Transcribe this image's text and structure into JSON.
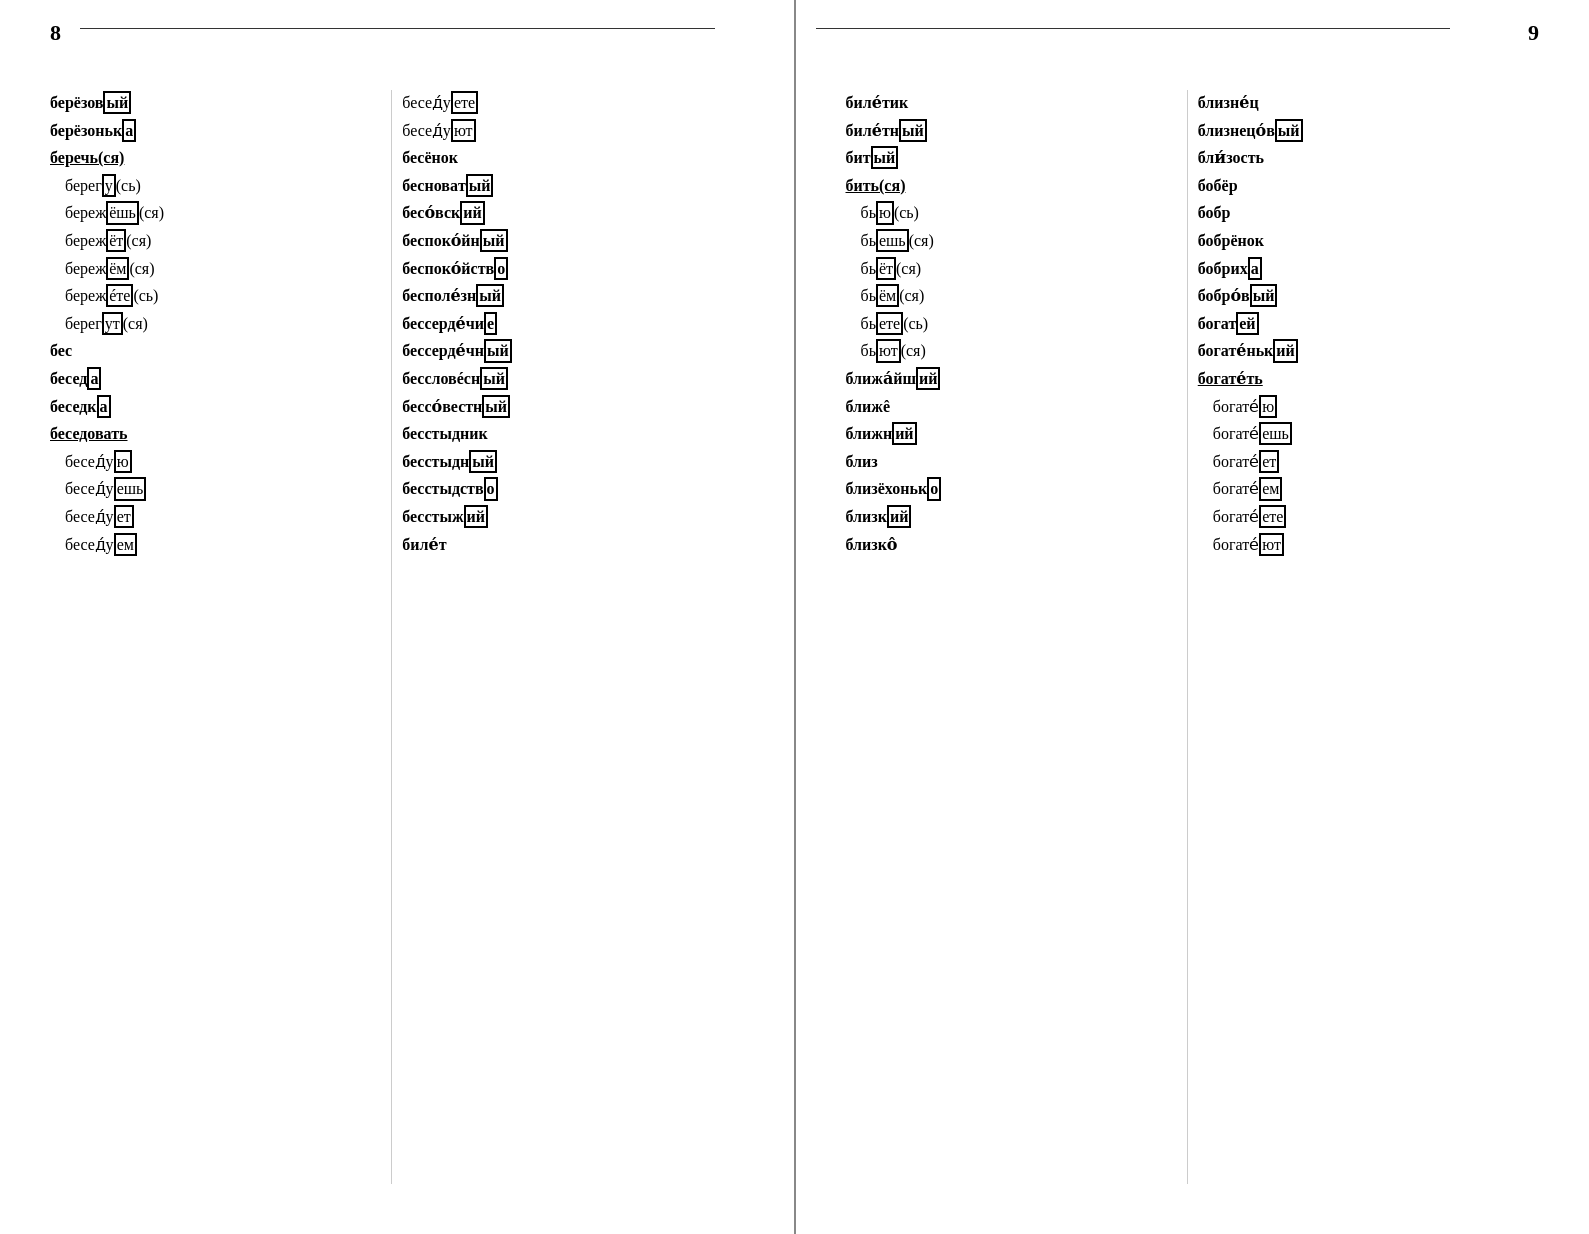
{
  "page_left": {
    "number": "8",
    "columns": [
      {
        "id": "col1",
        "entries": [
          {
            "text": "берёзов|ый",
            "bold": true
          },
          {
            "text": "берёзоньк|а",
            "bold": true
          },
          {
            "text": "беречь(ся)",
            "bold": true,
            "underline": true
          },
          {
            "text": "берег|у|(сь)",
            "bold": false,
            "indent": true
          },
          {
            "text": "береж|ёшь|(ся)",
            "bold": false,
            "indent": true
          },
          {
            "text": "береж|ёт|(ся)",
            "bold": false,
            "indent": true
          },
          {
            "text": "береж|ём|(ся)",
            "bold": false,
            "indent": true
          },
          {
            "text": "береж|éте|(сь)",
            "bold": false,
            "indent": true
          },
          {
            "text": "берег|ут|(ся)",
            "bold": false,
            "indent": true
          },
          {
            "text": "бес",
            "bold": true
          },
          {
            "text": "бесед|а",
            "bold": true
          },
          {
            "text": "беседк|а",
            "bold": true
          },
          {
            "text": "беседовать",
            "bold": true,
            "underline": true
          },
          {
            "text": "беседу|ю",
            "bold": false,
            "indent": true
          },
          {
            "text": "беседу|ешь",
            "bold": false,
            "indent": true
          },
          {
            "text": "беседу|ет",
            "bold": false,
            "indent": true
          },
          {
            "text": "беседу|ем",
            "bold": false,
            "indent": true
          }
        ]
      },
      {
        "id": "col2",
        "entries": [
          {
            "text": "беседу́|ете"
          },
          {
            "text": "беседу́|ют"
          },
          {
            "text": "бесёнок",
            "bold": true
          },
          {
            "text": "бесновáт|ый",
            "bold": true
          },
          {
            "text": "бесóвск|ий",
            "bold": true
          },
          {
            "text": "беспокóйн|ый",
            "bold": true
          },
          {
            "text": "беспокóйств|о",
            "bold": true
          },
          {
            "text": "бесполéзн|ый",
            "bold": true
          },
          {
            "text": "бессердéчи|е",
            "bold": true
          },
          {
            "text": "бессердéчн|ый",
            "bold": true
          },
          {
            "text": "бессловéсн|ый",
            "bold": true
          },
          {
            "text": "бессóвестн|ый",
            "bold": true
          },
          {
            "text": "бесстыдник",
            "bold": true
          },
          {
            "text": "бесстыдн|ый",
            "bold": true
          },
          {
            "text": "бесстыдств|о",
            "bold": true
          },
          {
            "text": "бесстыж|ий",
            "bold": true
          },
          {
            "text": "билет",
            "bold": true
          }
        ]
      }
    ]
  },
  "page_right": {
    "number": "9",
    "columns": [
      {
        "id": "col3",
        "entries": [
          {
            "text": "билетик",
            "bold": true
          },
          {
            "text": "билетн|ый",
            "bold": true
          },
          {
            "text": "бит|ый",
            "bold": true
          },
          {
            "text": "бить(ся)",
            "bold": true,
            "underline": true
          },
          {
            "text": "бь|ю|(сь)",
            "bold": false,
            "indent": true
          },
          {
            "text": "бь|ешь|(ся)",
            "bold": false,
            "indent": true
          },
          {
            "text": "бь|ёт|(ся)",
            "bold": false,
            "indent": true
          },
          {
            "text": "бь|ём|(ся)",
            "bold": false,
            "indent": true
          },
          {
            "text": "бь|ете|(сь)",
            "bold": false,
            "indent": true
          },
          {
            "text": "бь|ют|(ся)",
            "bold": false,
            "indent": true
          },
          {
            "text": "ближáйш|ий",
            "bold": true
          },
          {
            "text": "ближé",
            "bold": true
          },
          {
            "text": "ближн|ий",
            "bold": true
          },
          {
            "text": "близ",
            "bold": true
          },
          {
            "text": "близёхоньк|о",
            "bold": true
          },
          {
            "text": "близк|ий",
            "bold": true
          },
          {
            "text": "близкó",
            "bold": true
          }
        ]
      },
      {
        "id": "col4",
        "entries": [
          {
            "text": "близнéц",
            "bold": true
          },
          {
            "text": "близнецóв|ый",
            "bold": true
          },
          {
            "text": "близость",
            "bold": true
          },
          {
            "text": "бобёр",
            "bold": true
          },
          {
            "text": "бобр",
            "bold": true
          },
          {
            "text": "бобрёнок",
            "bold": true
          },
          {
            "text": "бобрих|а",
            "bold": true
          },
          {
            "text": "бобрóв|ый",
            "bold": true
          },
          {
            "text": "богат|ей",
            "bold": true
          },
          {
            "text": "богатéньк|ий",
            "bold": true
          },
          {
            "text": "богатéть",
            "bold": true,
            "underline": true
          },
          {
            "text": "богате́|ю",
            "bold": false,
            "indent": true
          },
          {
            "text": "богате́|ешь",
            "bold": false,
            "indent": true
          },
          {
            "text": "богате́|ет",
            "bold": false,
            "indent": true
          },
          {
            "text": "богате́|ем",
            "bold": false,
            "indent": true
          },
          {
            "text": "богате́|ете",
            "bold": false,
            "indent": true
          },
          {
            "text": "богате́|ют",
            "bold": false,
            "indent": true
          }
        ]
      }
    ]
  }
}
